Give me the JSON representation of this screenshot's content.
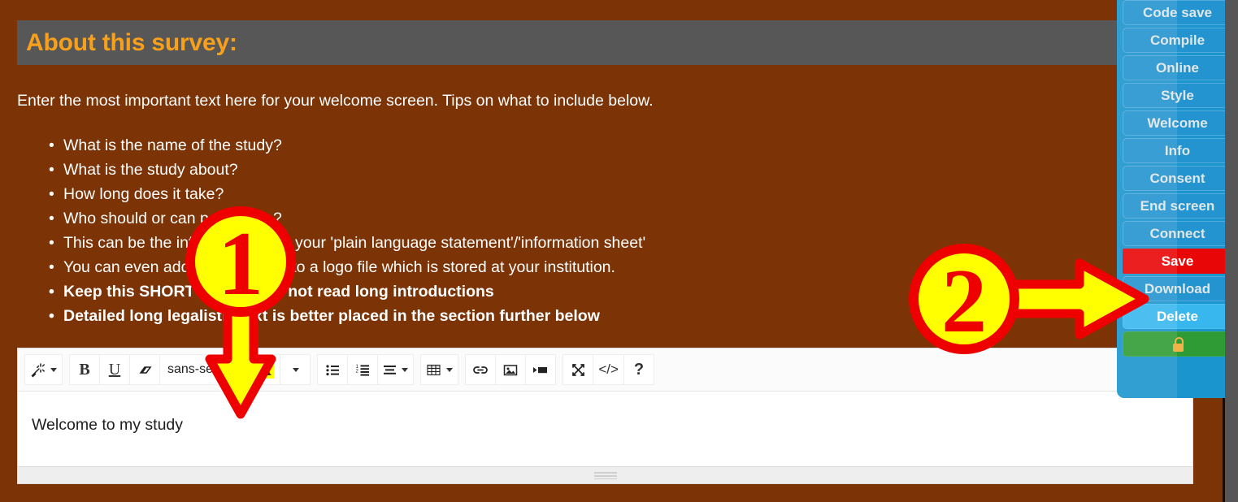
{
  "header": {
    "title": "About this survey:",
    "title_color": "#f9a01b",
    "bar_color": "#575757"
  },
  "page": {
    "background_color": "#7c3305",
    "intro": "Enter the most important text here for your welcome screen. Tips on what to include below."
  },
  "tips": [
    {
      "text": "What is the name of the study?",
      "bold": false
    },
    {
      "text": "What is the study about?",
      "bold": false
    },
    {
      "text": "How long does it take?",
      "bold": false
    },
    {
      "text": "Who should or can participate?",
      "bold": false
    },
    {
      "text": "This can be the information from your 'plain language statement'/'information sheet'",
      "bold": false
    },
    {
      "text": "You can even add an image link to a logo file which is stored at your institution.",
      "bold": false
    },
    {
      "text": "Keep this SHORT - people do not read long introductions",
      "bold": true
    },
    {
      "text": "Detailed long legalistic text is better placed in the section further below",
      "bold": true
    }
  ],
  "editor": {
    "content": "Welcome to my study",
    "font_selector_label": "sans-serif",
    "toolbar": [
      {
        "name": "magic-wand-icon",
        "label": "",
        "has_caret": true
      },
      {
        "name": "bold-icon",
        "label": "B",
        "has_caret": false
      },
      {
        "name": "underline-icon",
        "label": "U",
        "has_caret": false
      },
      {
        "name": "eraser-icon",
        "label": "",
        "has_caret": false
      },
      {
        "name": "font-family-select",
        "label": "sans-serif",
        "has_caret": true
      },
      {
        "name": "text-highlight-icon",
        "label": "A",
        "has_caret": false
      },
      {
        "name": "text-color-dropdown",
        "label": "",
        "has_caret": true
      },
      {
        "name": "unordered-list-icon",
        "label": "",
        "has_caret": false
      },
      {
        "name": "ordered-list-icon",
        "label": "",
        "has_caret": false
      },
      {
        "name": "align-icon",
        "label": "",
        "has_caret": true
      },
      {
        "name": "table-icon",
        "label": "",
        "has_caret": true
      },
      {
        "name": "link-icon",
        "label": "",
        "has_caret": false
      },
      {
        "name": "image-icon",
        "label": "",
        "has_caret": false
      },
      {
        "name": "video-icon",
        "label": "",
        "has_caret": false
      },
      {
        "name": "fullscreen-icon",
        "label": "",
        "has_caret": false
      },
      {
        "name": "code-view-icon",
        "label": "</>",
        "has_caret": false
      },
      {
        "name": "help-icon",
        "label": "?",
        "has_caret": false
      }
    ],
    "resize_grip": "resize-grip"
  },
  "side_nav": {
    "accent_color": "#1b95ce",
    "items": [
      {
        "label": "Code save",
        "style": "normal"
      },
      {
        "label": "Compile",
        "style": "normal"
      },
      {
        "label": "Online",
        "style": "normal"
      },
      {
        "label": "Style",
        "style": "normal"
      },
      {
        "label": "Welcome",
        "style": "normal"
      },
      {
        "label": "Info",
        "style": "normal"
      },
      {
        "label": "Consent",
        "style": "normal"
      },
      {
        "label": "End screen",
        "style": "normal"
      },
      {
        "label": "Connect",
        "style": "normal"
      },
      {
        "label": "Save",
        "style": "save"
      },
      {
        "label": "Download",
        "style": "normal"
      },
      {
        "label": "Delete",
        "style": "delete"
      },
      {
        "label": "",
        "style": "lock"
      }
    ]
  },
  "annotations": [
    {
      "id": "1",
      "number": "1",
      "shape": "circle-with-down-arrow",
      "fill": "#ffff00",
      "stroke": "#ee0000"
    },
    {
      "id": "2",
      "number": "2",
      "shape": "circle-with-right-arrow",
      "fill": "#ffff00",
      "stroke": "#ee0000"
    }
  ]
}
